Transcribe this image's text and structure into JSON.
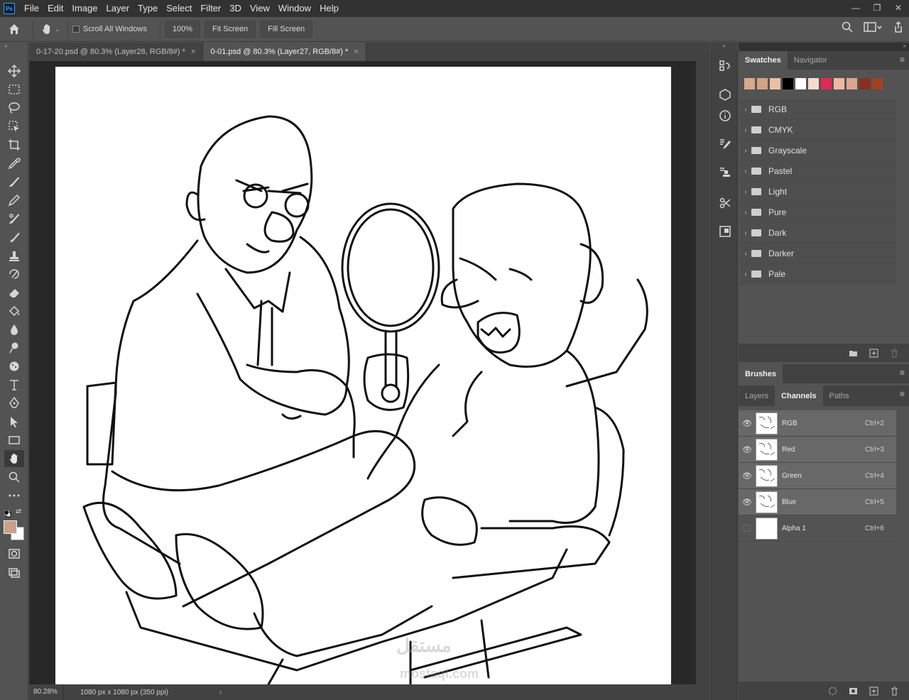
{
  "app": {
    "logo": "Ps"
  },
  "menu": [
    "File",
    "Edit",
    "Image",
    "Layer",
    "Type",
    "Select",
    "Filter",
    "3D",
    "View",
    "Window",
    "Help"
  ],
  "window_controls": {
    "minimize": "—",
    "restore": "❐",
    "close": "✕"
  },
  "options": {
    "scroll_all_windows": "Scroll All Windows",
    "zoom": "100%",
    "fit_screen": "Fit Screen",
    "fill_screen": "Fill Screen"
  },
  "tabs": [
    {
      "label": "0-17-20.psd @ 80.3% (Layer28, RGB/8#) *",
      "close": "×"
    },
    {
      "label": "0-01.psd @ 80.3% (Layer27, RGB/8#) *",
      "close": "×"
    }
  ],
  "status": {
    "zoom": "80.28%",
    "doc_size": "1080 px x 1080 px (350 ppi)",
    "arrow": "›"
  },
  "colors": {
    "foreground": "#c9a088",
    "background": "#ffffff",
    "accent": "#31a8ff"
  },
  "swatches": {
    "tabs": [
      "Swatches",
      "Navigator"
    ],
    "colors": [
      "#d9a98e",
      "#d4a284",
      "#e8c0a5",
      "#000000",
      "#ffffff",
      "#f3dcd0",
      "#e02a55",
      "#efb9a0",
      "#dba68c",
      "#8a2e1f",
      "#a0401f"
    ],
    "folders": [
      "RGB",
      "CMYK",
      "Grayscale",
      "Pastel",
      "Light",
      "Pure",
      "Dark",
      "Darker",
      "Pale"
    ]
  },
  "brushes": {
    "tab": "Brushes"
  },
  "channels": {
    "tabs": [
      "Layers",
      "Channels",
      "Paths"
    ],
    "rows": [
      {
        "name": "RGB",
        "shortcut": "Ctrl+2"
      },
      {
        "name": "Red",
        "shortcut": "Ctrl+3"
      },
      {
        "name": "Green",
        "shortcut": "Ctrl+4"
      },
      {
        "name": "Blue",
        "shortcut": "Ctrl+5"
      },
      {
        "name": "Alpha 1",
        "shortcut": "Ctrl+6"
      }
    ]
  },
  "watermark": {
    "arabic": "مستقل",
    "latin": "mostaql.com"
  }
}
